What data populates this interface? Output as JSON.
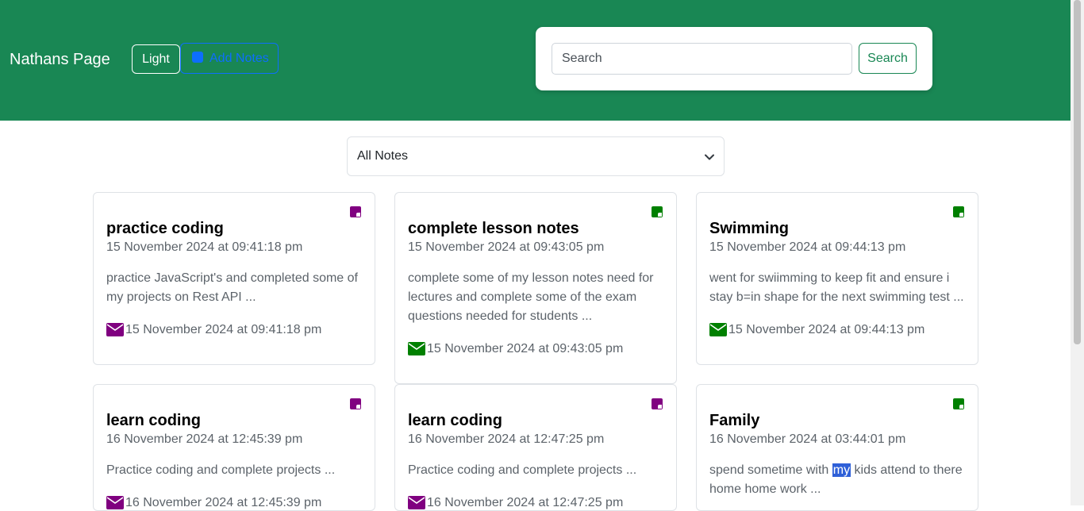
{
  "header": {
    "brand": "Nathans Page",
    "theme_toggle_label": "Light",
    "add_notes_label": "Add Notes",
    "search_placeholder": "Search",
    "search_button_label": "Search"
  },
  "filter": {
    "selected": "All Notes"
  },
  "colors": {
    "header_bg": "#198754",
    "purple": "#800080",
    "green": "#008000"
  },
  "notes": [
    {
      "title": "practice coding",
      "date": "15 November 2024 at 09:41:18 pm",
      "body": "practice JavaScript's and completed some of my projects on Rest API ...",
      "footer_date": "15 November 2024 at 09:41:18 pm",
      "color": "purple"
    },
    {
      "title": "complete lesson notes",
      "date": "15 November 2024 at 09:43:05 pm",
      "body": "complete some of my lesson notes need for lectures and complete some of the exam questions needed for students ...",
      "footer_date": "15 November 2024 at 09:43:05 pm",
      "color": "green"
    },
    {
      "title": "Swimming",
      "date": "15 November 2024 at 09:44:13 pm",
      "body": "went for swiimming to keep fit and ensure i stay b=in shape for the next swimming test ...",
      "footer_date": "15 November 2024 at 09:44:13 pm",
      "color": "green"
    },
    {
      "title": "learn coding",
      "date": "16 November 2024 at 12:45:39 pm",
      "body": "Practice coding and complete projects ...",
      "footer_date": "16 November 2024 at 12:45:39 pm",
      "color": "purple"
    },
    {
      "title": "learn coding",
      "date": "16 November 2024 at 12:47:25 pm",
      "body": "Practice coding and complete projects ...",
      "footer_date": "16 November 2024 at 12:47:25 pm",
      "color": "purple"
    },
    {
      "title": "Family",
      "date": "16 November 2024 at 03:44:01 pm",
      "body_before": "spend sometime with ",
      "body_highlight": "my",
      "body_after": " kids attend to there home home work ...",
      "color": "green"
    }
  ]
}
